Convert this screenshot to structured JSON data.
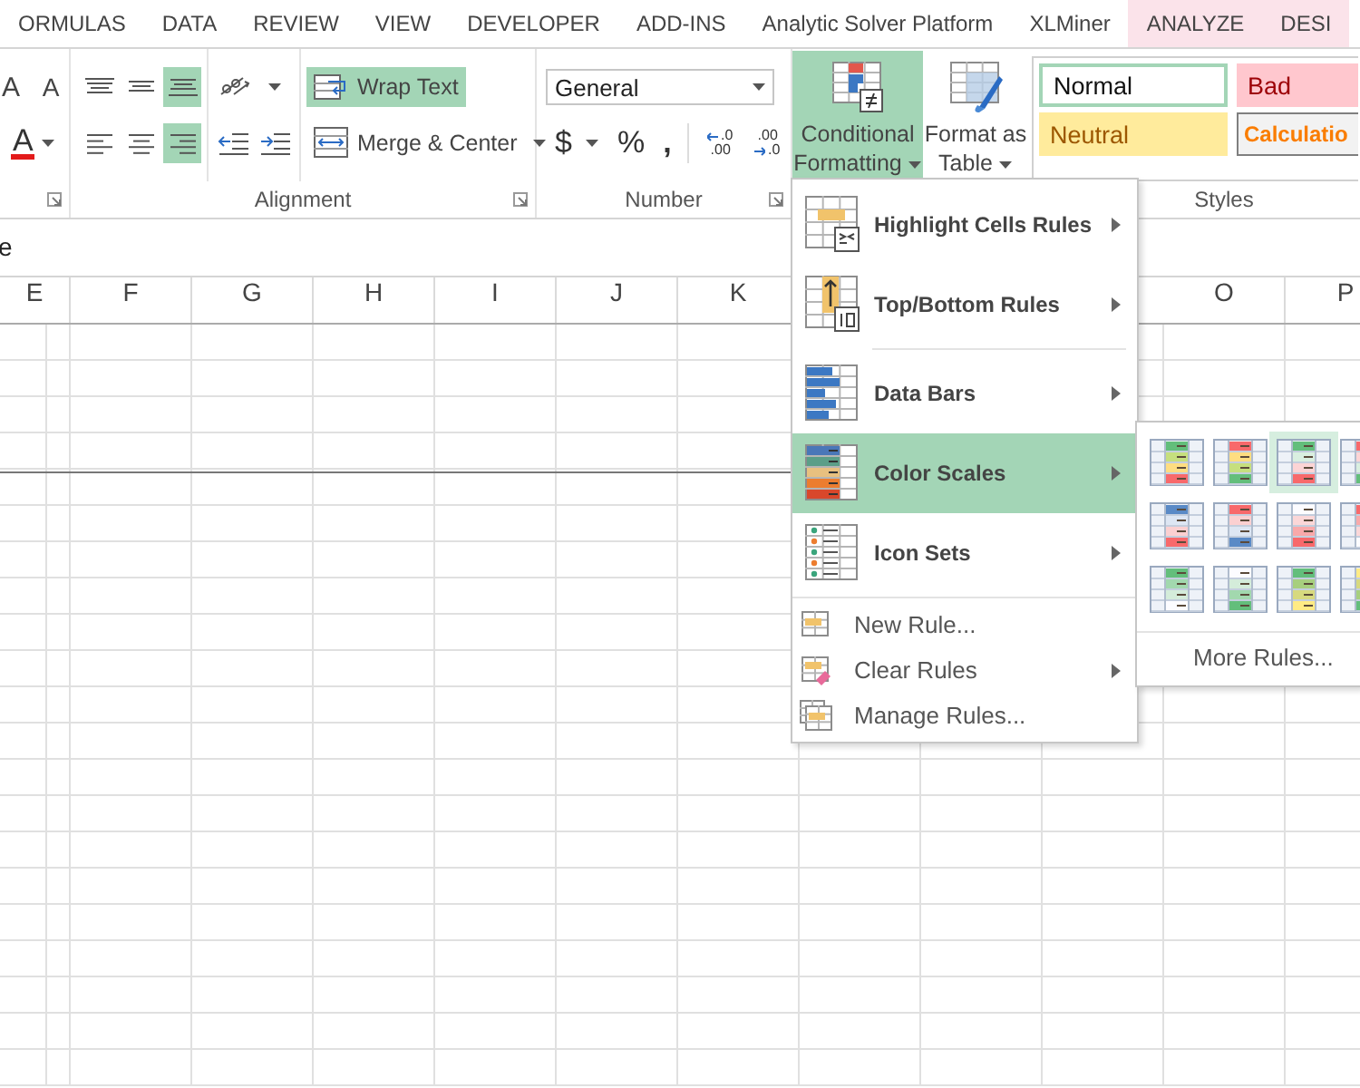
{
  "tabs": [
    {
      "label": "ORMULAS",
      "contextual": false
    },
    {
      "label": "DATA",
      "contextual": false
    },
    {
      "label": "REVIEW",
      "contextual": false
    },
    {
      "label": "VIEW",
      "contextual": false
    },
    {
      "label": "DEVELOPER",
      "contextual": false
    },
    {
      "label": "ADD-INS",
      "contextual": false
    },
    {
      "label": "Analytic Solver Platform",
      "contextual": false
    },
    {
      "label": "XLMiner",
      "contextual": false
    },
    {
      "label": "ANALYZE",
      "contextual": true
    },
    {
      "label": "DESI",
      "contextual": true
    }
  ],
  "ribbon": {
    "font": {
      "grow_button": "A",
      "shrink_button": "A",
      "text_tint_button": "A"
    },
    "alignment": {
      "label": "Alignment",
      "vertical_align": [
        {
          "selected": false
        },
        {
          "selected": false
        },
        {
          "selected": true
        }
      ],
      "horizontal_align": [
        {
          "selected": false
        },
        {
          "selected": false
        },
        {
          "selected": true
        }
      ],
      "wrap_text": {
        "label": "Wrap Text",
        "selected": true
      },
      "merge": {
        "label": "Merge & Center"
      }
    },
    "number": {
      "label": "Number",
      "format": "General",
      "symbols": [
        "$",
        "%",
        ","
      ],
      "decimals": [
        {
          "top": ".0",
          "bottom": ".00"
        },
        {
          "top": ".00",
          "bottom": ".0"
        }
      ]
    },
    "styles": {
      "label": "Styles",
      "conditional_formatting": {
        "label": "Conditional Formatting",
        "selected": true
      },
      "format_as_table": {
        "label": "Format as Table"
      },
      "cell_styles": [
        {
          "label": "Normal",
          "kind": "normal",
          "selected": true
        },
        {
          "label": "Bad",
          "kind": "bad",
          "selected": false
        },
        {
          "label": "Neutral",
          "kind": "neutral",
          "selected": false
        },
        {
          "label": "Calculatio",
          "kind": "calculation",
          "selected": false
        }
      ]
    }
  },
  "formula_bar": {
    "value": "e"
  },
  "columns_left": [
    "E",
    "F",
    "G",
    "H",
    "I",
    "J",
    "K"
  ],
  "columns_right": [
    "O",
    "P"
  ],
  "menu": {
    "sections": [
      [
        {
          "label": "Highlight Cells Rules",
          "kind": "large",
          "submenu": true,
          "selected": false
        },
        {
          "label": "Top/Bottom Rules",
          "kind": "large",
          "submenu": true,
          "selected": false
        }
      ],
      [
        {
          "label": "Data Bars",
          "kind": "large",
          "submenu": true,
          "selected": false
        },
        {
          "label": "Color Scales",
          "kind": "large",
          "submenu": true,
          "selected": true
        },
        {
          "label": "Icon Sets",
          "kind": "large",
          "submenu": true,
          "selected": false
        }
      ],
      [
        {
          "label": "New Rule...",
          "kind": "small",
          "submenu": false,
          "selected": false
        },
        {
          "label": "Clear Rules",
          "kind": "small",
          "submenu": true,
          "selected": false
        },
        {
          "label": "Manage Rules...",
          "kind": "small",
          "submenu": false,
          "selected": false
        }
      ]
    ]
  },
  "color_scales": {
    "swatches": [
      {
        "selected": false
      },
      {
        "selected": false
      },
      {
        "selected": true
      },
      {
        "selected": false
      },
      {
        "selected": false
      },
      {
        "selected": false
      },
      {
        "selected": false
      },
      {
        "selected": false
      },
      {
        "selected": false
      },
      {
        "selected": false
      },
      {
        "selected": false
      },
      {
        "selected": false
      }
    ],
    "more_rules": "More Rules..."
  }
}
